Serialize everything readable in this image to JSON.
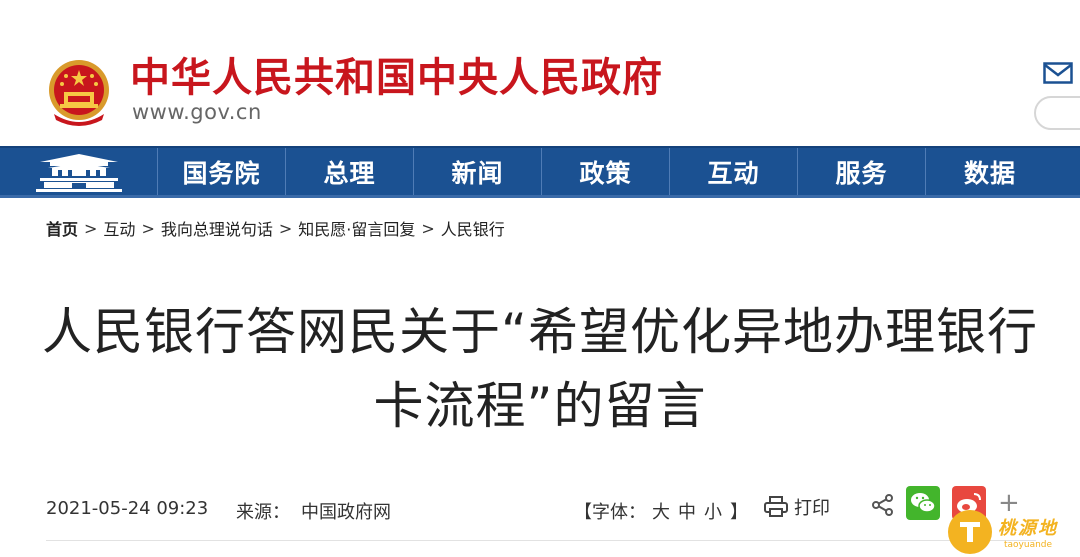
{
  "header": {
    "site_title": "中华人民共和国中央人民政府",
    "site_url": "www.gov.cn"
  },
  "nav": {
    "items": [
      "国务院",
      "总理",
      "新闻",
      "政策",
      "互动",
      "服务",
      "数据"
    ]
  },
  "breadcrumb": {
    "items": [
      "首页",
      "互动",
      "我向总理说句话",
      "知民愿·留言回复",
      "人民银行"
    ],
    "separator": ">"
  },
  "article": {
    "title": "人民银行答网民关于“希望优化异地办理银行卡流程”的留言"
  },
  "meta": {
    "date": "2021-05-24 09:23",
    "source_label": "来源：",
    "source_value": "中国政府网",
    "font_size_open": "【字体：",
    "font_size_options": [
      "大",
      "中",
      "小"
    ],
    "font_size_close": "】",
    "print_label": "打印"
  },
  "watermark": {
    "text": "桃源地",
    "sub": "taoyuande"
  },
  "colors": {
    "brand_red": "#c8161d",
    "nav_blue": "#1b5192",
    "wechat_green": "#43b52c",
    "weibo_red": "#e8483f"
  }
}
